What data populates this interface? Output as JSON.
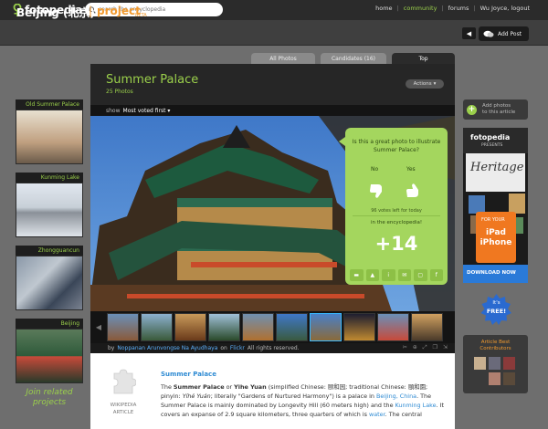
{
  "topbar": {
    "logo": "fotopedia",
    "search_placeholder": "search the encyclopedia",
    "nav": [
      "home",
      "community",
      "forums",
      "Wu Joyce, logout"
    ],
    "nav_active_index": 1
  },
  "header": {
    "city": "Beijing (北京)",
    "separator": "|",
    "project": "project",
    "beta": "BETA",
    "back_icon": "◀",
    "add_post": "Add Post"
  },
  "tabs": [
    "All Photos",
    "Candidates (16)",
    "Top"
  ],
  "main": {
    "title": "Summer Palace",
    "photo_count": "25 Photos",
    "actions": "Actions",
    "show_label": "show",
    "sort_value": "Most voted first ▾"
  },
  "vote": {
    "question": "Is this a great photo to illustrate Summer Palace?",
    "no": "No",
    "yes": "Yes",
    "votes_left": "96 votes left for today",
    "in_encyclopedia": "in the encyclopedia!",
    "count": "+14"
  },
  "credit": {
    "by": "by",
    "author": "Noppanan Arunvongse Na Ayudhaya",
    "on": "on",
    "source": "Flickr",
    "rights": "All rights reserved."
  },
  "wiki": {
    "label_line1": "WIKIPEDIA",
    "label_line2": "ARTICLE",
    "title": "Summer Palace",
    "text_lines": [
      {
        "plain1": "The ",
        "bold": "Summer Palace",
        "plain2": " or ",
        "bold2": "Yihe Yuan",
        "plain3": " (simplified Chinese: 颐和园; traditional Chinese: 頤和園;"
      },
      {
        "plain1": "pinyin: ",
        "italic": "Yíhé Yuán",
        "plain2": "; literally \"Gardens of Nurtured Harmony\") is a palace in ",
        "link": "Beijing, China",
        "plain3": ". The"
      },
      {
        "plain1": "Summer Palace is mainly dominated by Longevity Hill (60 meters high) and the ",
        "link": "Kunming Lake",
        "plain2": ". It"
      },
      {
        "plain1": "covers an expanse of 2.9 square kilometers, three quarters of which is ",
        "link": "water",
        "plain2": ". The central"
      }
    ]
  },
  "sidebar_left": [
    {
      "label": "Old Summer Palace"
    },
    {
      "label": "Kunming Lake"
    },
    {
      "label": "Zhongguancun"
    },
    {
      "label": "Beijing"
    }
  ],
  "join": "Join related projects",
  "sidebar_right": {
    "add_photos_line1": "Add photos",
    "add_photos_line2": "to this article",
    "ad_brand": "fotopedia",
    "ad_presents": "PRESENTS",
    "ad_title": "Heritage",
    "ad_for_your": "FOR YOUR",
    "ad_device": "iPad iPhone",
    "ad_download": "DOWNLOAD NOW",
    "free_line1": "It's",
    "free_line2": "FREE!",
    "contributors_line1": "Article Best",
    "contributors_line2": "Contributors"
  },
  "colors": {
    "accent_green": "#9bd04b",
    "accent_orange": "#f29a2e",
    "vote_bg": "#a4d65e",
    "link_blue": "#2f8bd3"
  }
}
